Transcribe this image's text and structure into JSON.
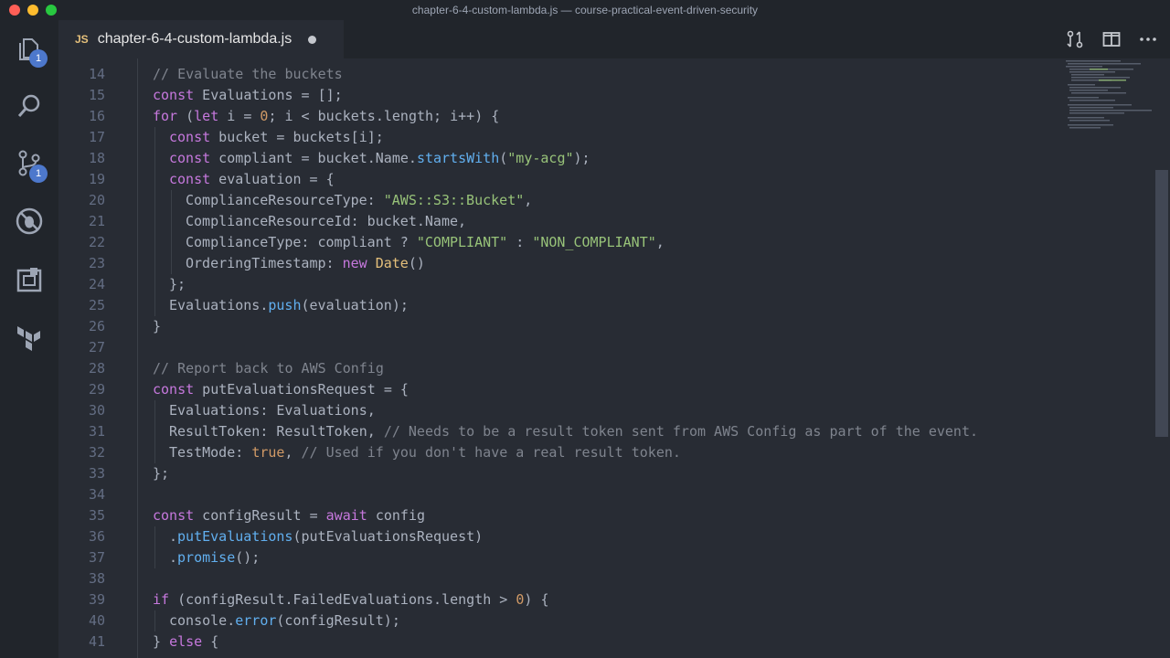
{
  "window": {
    "title": "chapter-6-4-custom-lambda.js — course-practical-event-driven-security"
  },
  "activity_bar": {
    "explorer_badge": "1",
    "source_control_badge": "1"
  },
  "tab": {
    "lang_badge": "JS",
    "title": "chapter-6-4-custom-lambda.js"
  },
  "colors": {
    "accent": "#4d78cc",
    "editor_bg": "#282c34",
    "chrome_bg": "#21252b"
  },
  "editor": {
    "lines": [
      {
        "n": "14",
        "indent": 1,
        "tokens": [
          [
            "c",
            "// Evaluate the buckets"
          ]
        ]
      },
      {
        "n": "15",
        "indent": 1,
        "tokens": [
          [
            "k",
            "const"
          ],
          [
            "p",
            " Evaluations = [];"
          ]
        ]
      },
      {
        "n": "16",
        "indent": 1,
        "tokens": [
          [
            "k",
            "for"
          ],
          [
            "p",
            " ("
          ],
          [
            "k",
            "let"
          ],
          [
            "p",
            " i = "
          ],
          [
            "n",
            "0"
          ],
          [
            "p",
            "; i < buckets.length; i++) {"
          ]
        ]
      },
      {
        "n": "17",
        "indent": 2,
        "tokens": [
          [
            "k",
            "const"
          ],
          [
            "p",
            " bucket = buckets[i];"
          ]
        ]
      },
      {
        "n": "18",
        "indent": 2,
        "tokens": [
          [
            "k",
            "const"
          ],
          [
            "p",
            " compliant = bucket.Name."
          ],
          [
            "f",
            "startsWith"
          ],
          [
            "p",
            "("
          ],
          [
            "s",
            "\"my-acg\""
          ],
          [
            "p",
            ");"
          ]
        ]
      },
      {
        "n": "19",
        "indent": 2,
        "tokens": [
          [
            "k",
            "const"
          ],
          [
            "p",
            " evaluation = {"
          ]
        ]
      },
      {
        "n": "20",
        "indent": 3,
        "tokens": [
          [
            "p",
            "ComplianceResourceType: "
          ],
          [
            "s",
            "\"AWS::S3::Bucket\""
          ],
          [
            "p",
            ","
          ]
        ]
      },
      {
        "n": "21",
        "indent": 3,
        "tokens": [
          [
            "p",
            "ComplianceResourceId: bucket.Name,"
          ]
        ]
      },
      {
        "n": "22",
        "indent": 3,
        "tokens": [
          [
            "p",
            "ComplianceType: compliant ? "
          ],
          [
            "s",
            "\"COMPLIANT\""
          ],
          [
            "p",
            " : "
          ],
          [
            "s",
            "\"NON_COMPLIANT\""
          ],
          [
            "p",
            ","
          ]
        ]
      },
      {
        "n": "23",
        "indent": 3,
        "tokens": [
          [
            "p",
            "OrderingTimestamp: "
          ],
          [
            "k",
            "new"
          ],
          [
            "p",
            " "
          ],
          [
            "t",
            "Date"
          ],
          [
            "p",
            "()"
          ]
        ]
      },
      {
        "n": "24",
        "indent": 2,
        "tokens": [
          [
            "p",
            "};"
          ]
        ]
      },
      {
        "n": "25",
        "indent": 2,
        "tokens": [
          [
            "p",
            "Evaluations."
          ],
          [
            "f",
            "push"
          ],
          [
            "p",
            "(evaluation);"
          ]
        ]
      },
      {
        "n": "26",
        "indent": 1,
        "tokens": [
          [
            "p",
            "}"
          ]
        ]
      },
      {
        "n": "27",
        "indent": 0,
        "tokens": []
      },
      {
        "n": "28",
        "indent": 1,
        "tokens": [
          [
            "c",
            "// Report back to AWS Config"
          ]
        ]
      },
      {
        "n": "29",
        "indent": 1,
        "tokens": [
          [
            "k",
            "const"
          ],
          [
            "p",
            " putEvaluationsRequest = {"
          ]
        ]
      },
      {
        "n": "30",
        "indent": 2,
        "tokens": [
          [
            "p",
            "Evaluations: Evaluations,"
          ]
        ]
      },
      {
        "n": "31",
        "indent": 2,
        "tokens": [
          [
            "p",
            "ResultToken: ResultToken, "
          ],
          [
            "c",
            "// Needs to be a result token sent from AWS Config as part of the event."
          ]
        ]
      },
      {
        "n": "32",
        "indent": 2,
        "tokens": [
          [
            "p",
            "TestMode: "
          ],
          [
            "n",
            "true"
          ],
          [
            "p",
            ", "
          ],
          [
            "c",
            "// Used if you don't have a real result token."
          ]
        ]
      },
      {
        "n": "33",
        "indent": 1,
        "tokens": [
          [
            "p",
            "};"
          ]
        ]
      },
      {
        "n": "34",
        "indent": 0,
        "tokens": []
      },
      {
        "n": "35",
        "indent": 1,
        "tokens": [
          [
            "k",
            "const"
          ],
          [
            "p",
            " configResult = "
          ],
          [
            "k",
            "await"
          ],
          [
            "p",
            " config"
          ]
        ]
      },
      {
        "n": "36",
        "indent": 2,
        "tokens": [
          [
            "p",
            "."
          ],
          [
            "f",
            "putEvaluations"
          ],
          [
            "p",
            "(putEvaluationsRequest)"
          ]
        ]
      },
      {
        "n": "37",
        "indent": 2,
        "tokens": [
          [
            "p",
            "."
          ],
          [
            "f",
            "promise"
          ],
          [
            "p",
            "();"
          ]
        ]
      },
      {
        "n": "38",
        "indent": 0,
        "tokens": []
      },
      {
        "n": "39",
        "indent": 1,
        "tokens": [
          [
            "k",
            "if"
          ],
          [
            "p",
            " (configResult.FailedEvaluations.length > "
          ],
          [
            "n",
            "0"
          ],
          [
            "p",
            ") {"
          ]
        ]
      },
      {
        "n": "40",
        "indent": 2,
        "tokens": [
          [
            "p",
            "console."
          ],
          [
            "f",
            "error"
          ],
          [
            "p",
            "(configResult);"
          ]
        ]
      },
      {
        "n": "41",
        "indent": 1,
        "tokens": [
          [
            "p",
            "} "
          ],
          [
            "k",
            "else"
          ],
          [
            "p",
            " {"
          ]
        ]
      }
    ]
  }
}
